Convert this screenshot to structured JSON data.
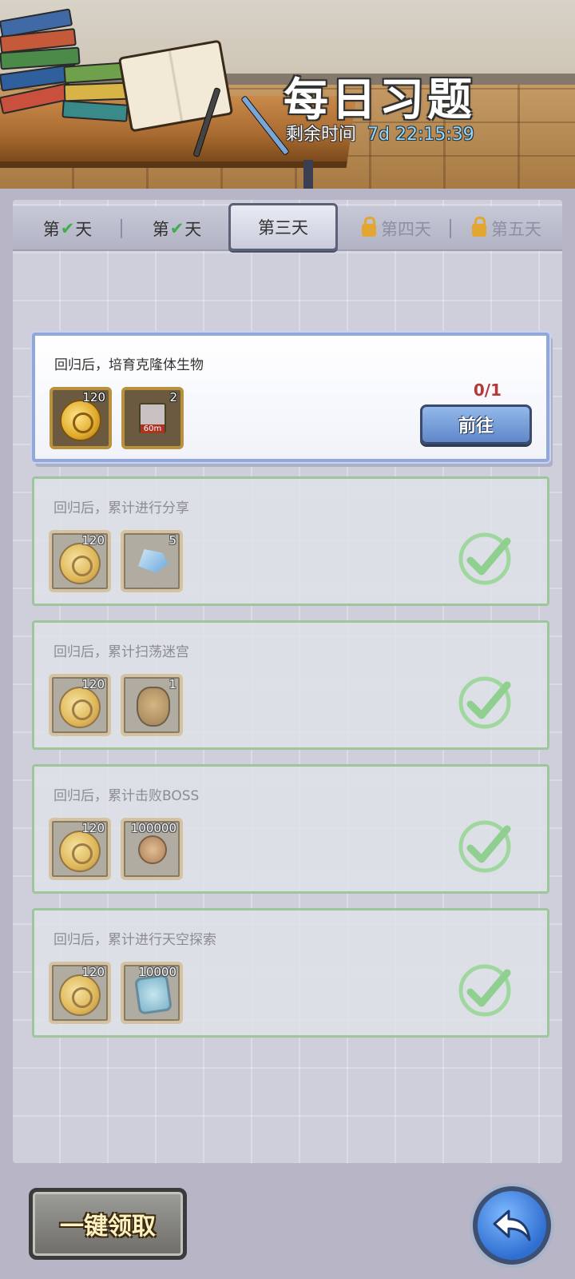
{
  "header": {
    "title": "每日习题",
    "remaining_label": "剩余时间",
    "remaining_time": "7d 22:15:39"
  },
  "tabs": [
    {
      "prefix": "第",
      "suffix": "天",
      "state": "completed",
      "icon": "check-icon"
    },
    {
      "prefix": "第",
      "suffix": "天",
      "state": "completed",
      "icon": "check-icon"
    },
    {
      "label": "第三天",
      "state": "active"
    },
    {
      "label": "第四天",
      "state": "locked",
      "icon": "lock-icon"
    },
    {
      "label": "第五天",
      "state": "locked",
      "icon": "lock-icon"
    }
  ],
  "tasks": [
    {
      "description": "回归后，培育克隆体生物",
      "status": "in_progress",
      "progress": "0/1",
      "button_label": "前往",
      "rewards": [
        {
          "icon": "gold-coin-icon",
          "count": "120"
        },
        {
          "icon": "timer-box-icon",
          "count": "2",
          "label": "60m"
        }
      ]
    },
    {
      "description": "回归后，累计进行分享",
      "status": "completed",
      "rewards": [
        {
          "icon": "gold-coin-icon",
          "count": "120"
        },
        {
          "icon": "blue-crystal-icon",
          "count": "5"
        }
      ]
    },
    {
      "description": "回归后，累计扫荡迷宫",
      "status": "completed",
      "rewards": [
        {
          "icon": "gold-coin-icon",
          "count": "120"
        },
        {
          "icon": "vase-icon",
          "count": "1"
        }
      ]
    },
    {
      "description": "回归后，累计击败BOSS",
      "status": "completed",
      "rewards": [
        {
          "icon": "gold-coin-icon",
          "count": "120"
        },
        {
          "icon": "bronze-medal-icon",
          "count": "100000"
        }
      ]
    },
    {
      "description": "回归后，累计进行天空探索",
      "status": "completed",
      "rewards": [
        {
          "icon": "gold-coin-icon",
          "count": "120"
        },
        {
          "icon": "gear-crystal-icon",
          "count": "10000"
        }
      ]
    }
  ],
  "footer": {
    "claim_all_label": "一键领取",
    "back_icon": "back-arrow-icon"
  },
  "colors": {
    "accent_blue": "#5f87c8",
    "check_green": "#3fae4b",
    "progress_red": "#b23a3a",
    "lock_gold": "#e3a630"
  }
}
